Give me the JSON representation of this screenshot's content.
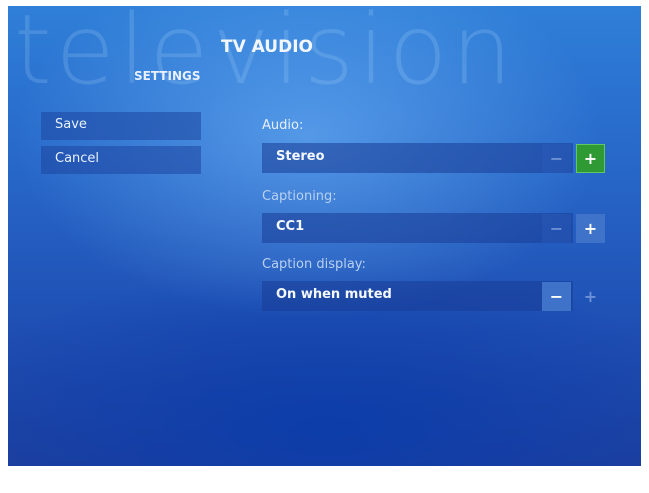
{
  "watermark": "television",
  "header": {
    "title": "TV AUDIO",
    "subtitle": "SETTINGS"
  },
  "sidebar": {
    "save_label": "Save",
    "cancel_label": "Cancel"
  },
  "settings": {
    "audio": {
      "label": "Audio:",
      "value": "Stereo",
      "minus": "−",
      "plus": "+"
    },
    "captioning": {
      "label": "Captioning:",
      "value": "CC1",
      "minus": "−",
      "plus": "+"
    },
    "caption_display": {
      "label": "Caption display:",
      "value": "On when muted",
      "minus": "−",
      "plus": "+"
    }
  },
  "colors": {
    "background": "#2767c8",
    "focus_green": "#2f9a34",
    "button_blue": "#3f72c9"
  }
}
